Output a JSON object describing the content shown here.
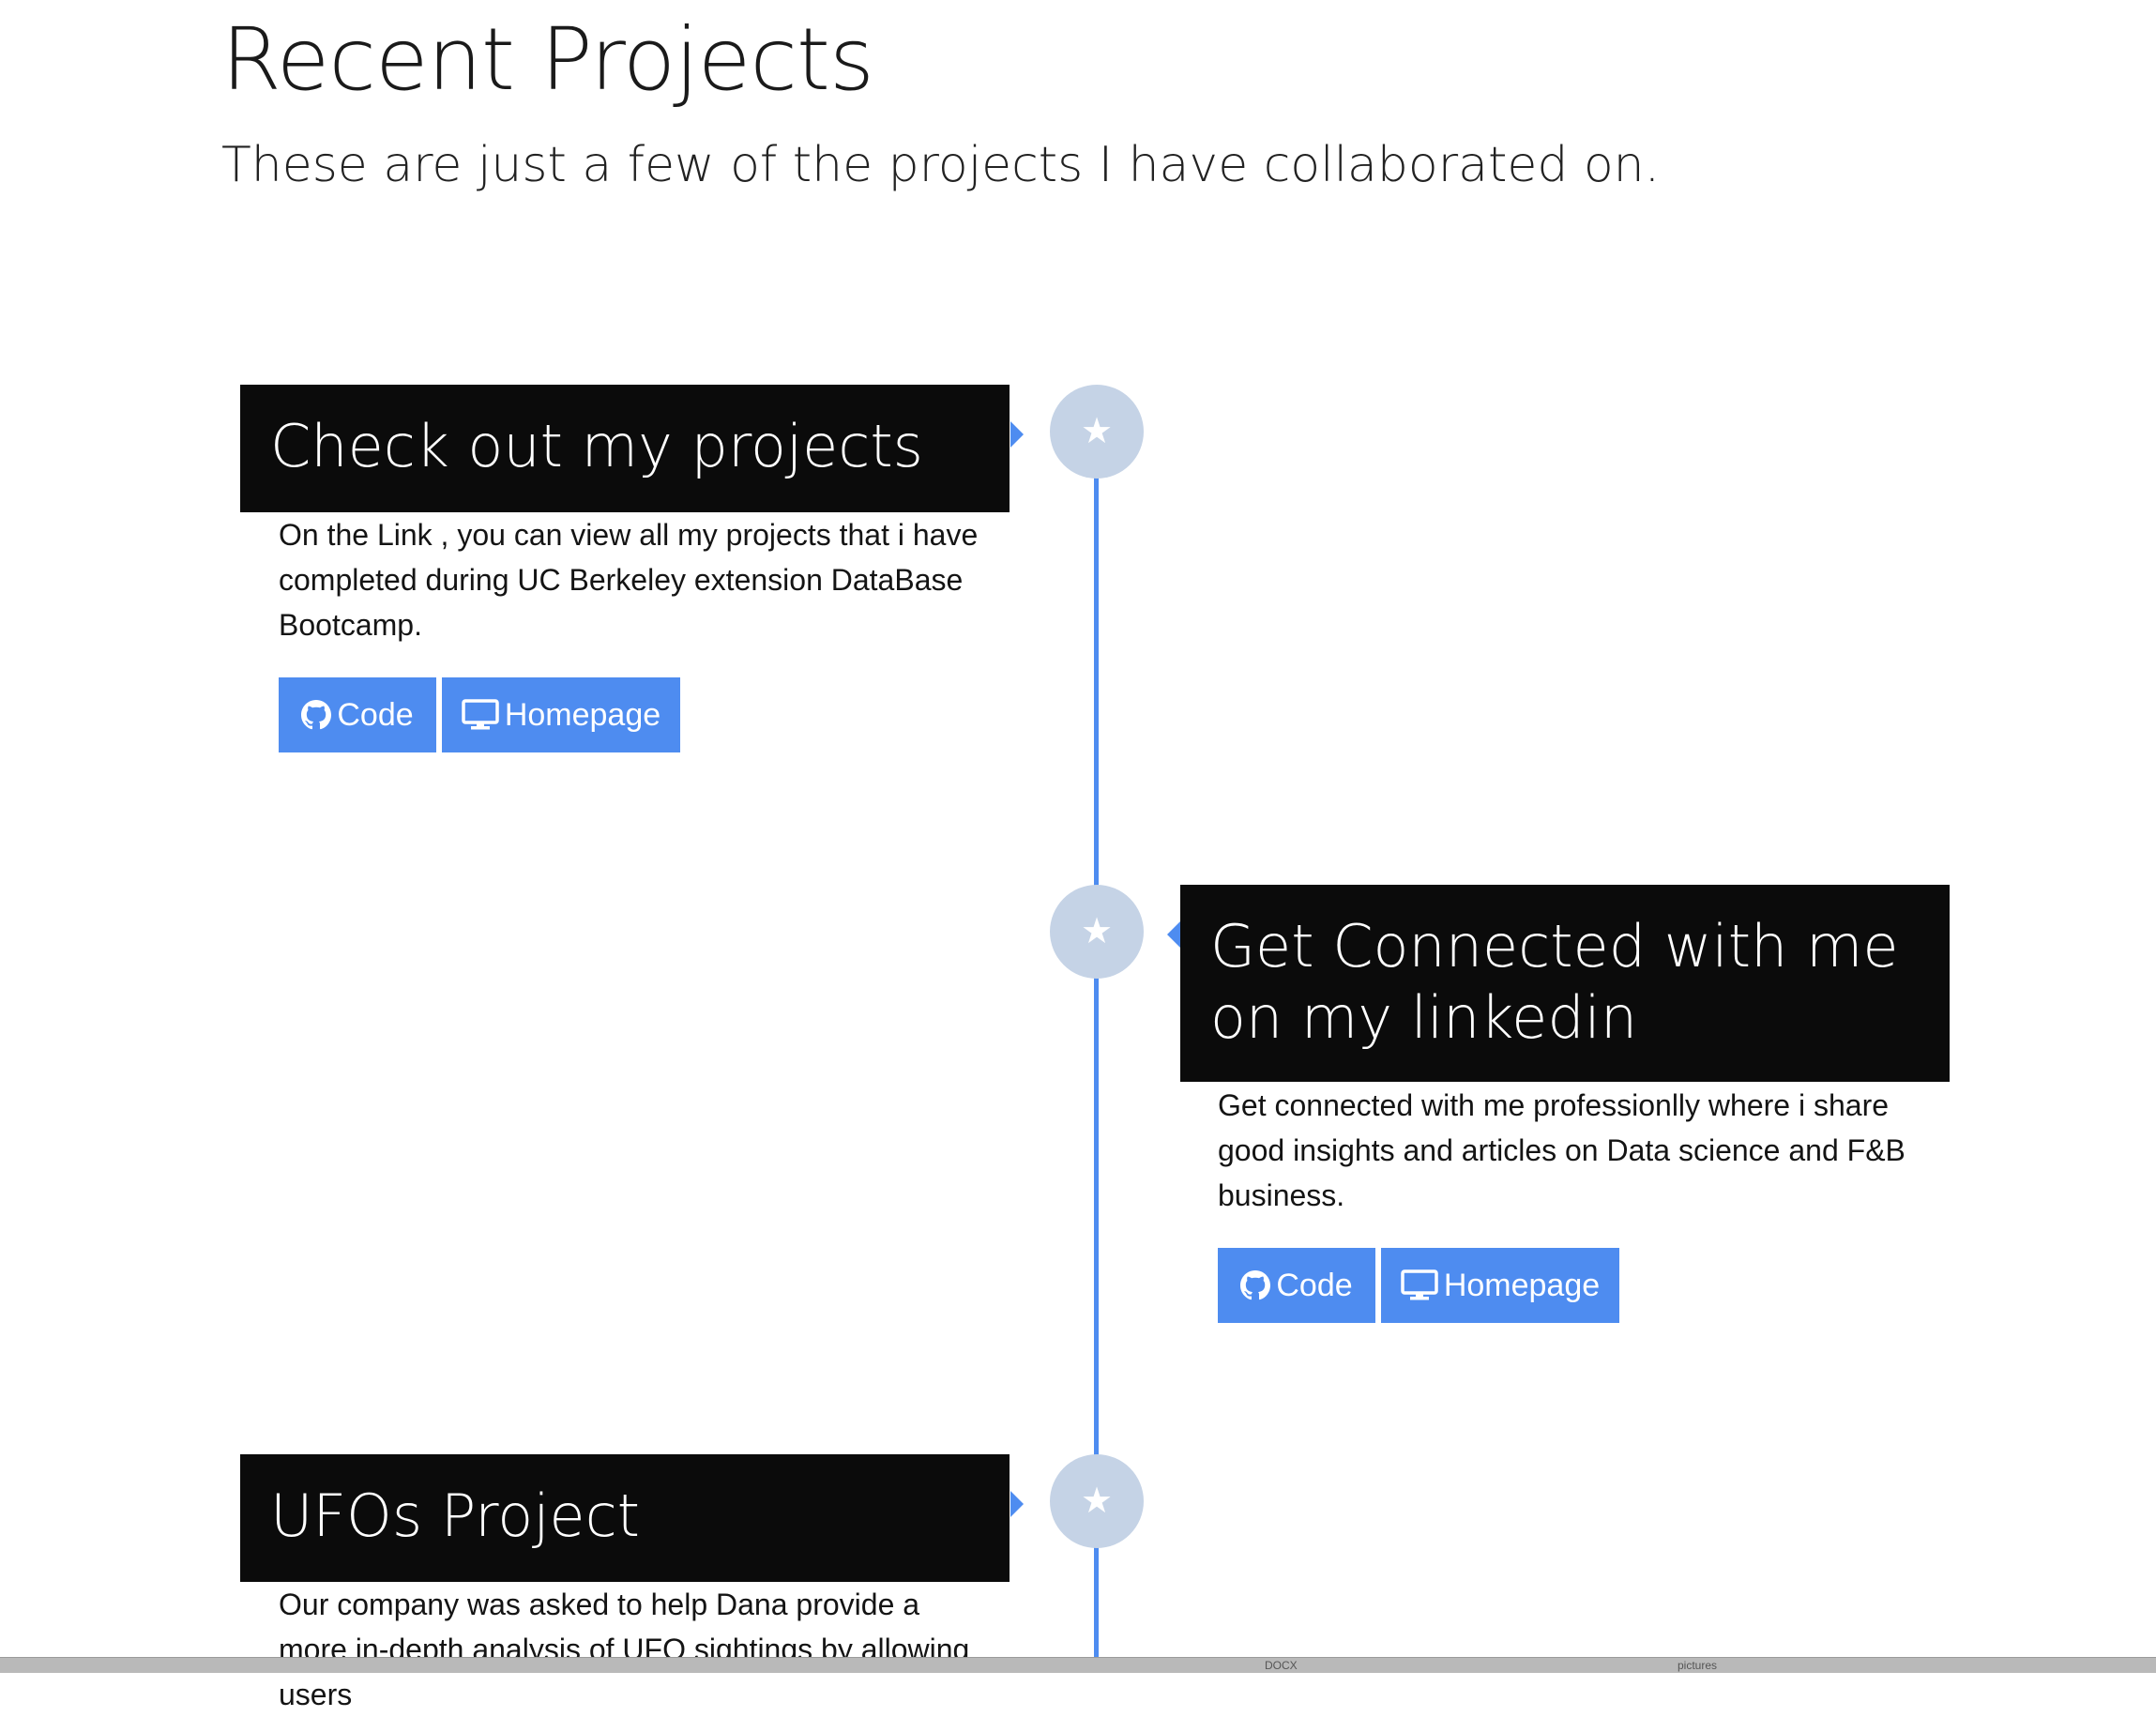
{
  "header": {
    "title": "Recent Projects",
    "subtitle": "These are just a few of the projects I have collaborated on."
  },
  "timeline": {
    "items": [
      {
        "heading": "Check out my projects",
        "body": "On the Link , you can view all my projects that i have completed during UC Berkeley extension DataBase Bootcamp.",
        "code_label": "Code",
        "homepage_label": "Homepage",
        "badge_icon": "star-icon"
      },
      {
        "heading": "Get Connected with me on my linkedin",
        "body": "Get connected with me professionlly where i share good insights and articles on Data science and F&B business.",
        "code_label": "Code",
        "homepage_label": "Homepage",
        "badge_icon": "star-icon"
      },
      {
        "heading": "UFOs Project",
        "body": "Our company was asked to help Dana provide a more in-depth analysis of UFO sightings by allowing users",
        "badge_icon": "star-icon"
      }
    ]
  },
  "taskbar": {
    "item1": "DOCX",
    "item2": "pictures"
  },
  "colors": {
    "accent": "#4e8cf0",
    "heading_bg": "#0b0b0b",
    "badge": "#c5d3e6"
  }
}
